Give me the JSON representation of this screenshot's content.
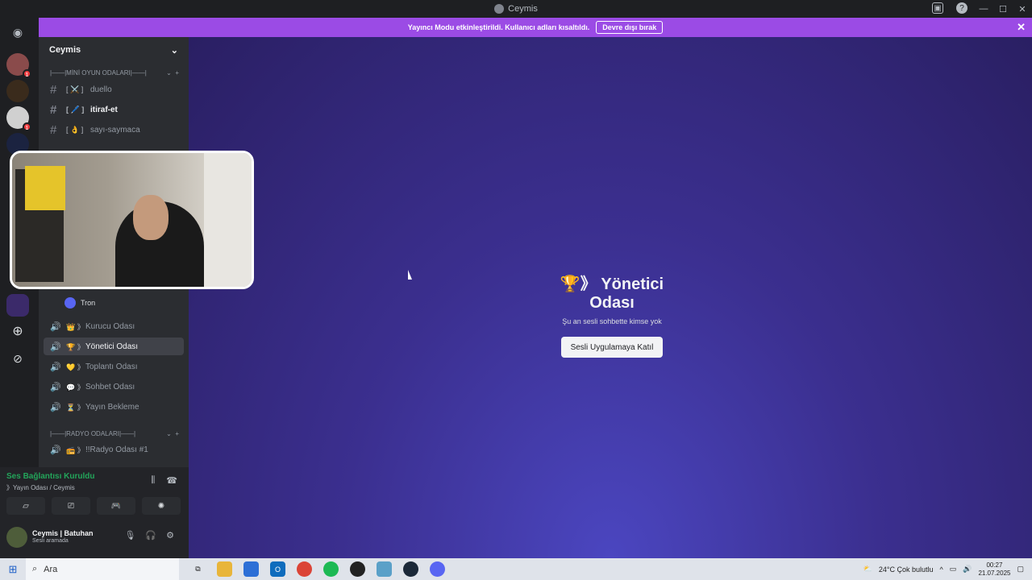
{
  "window": {
    "title": "Ceymis"
  },
  "banner": {
    "message": "Yayıncı Modu etkinleştirildi. Kullanıcı adları kısaltıldı.",
    "button_label": "Devre dışı bırak"
  },
  "guild": {
    "name": "Ceymis"
  },
  "categories": {
    "mini_games": "|——|MİNİ OYUN ODALARI|——|",
    "radio": "|——|RADYO ODALARI|——|"
  },
  "text_channels": [
    {
      "label": "duello",
      "emoji": "[ ⚔️ ]"
    },
    {
      "label": "itiraf-et",
      "emoji": "[ 🖊️ ]"
    },
    {
      "label": "sayı-saymaca",
      "emoji": "[ 👌 ]"
    }
  ],
  "voice_user": {
    "name": "Tron"
  },
  "voice_channels": [
    {
      "label": "Kurucu Odası",
      "emoji": "👑 》"
    },
    {
      "label": "Yönetici Odası",
      "emoji": "🏆 》"
    },
    {
      "label": "Toplantı Odası",
      "emoji": "💛 》"
    },
    {
      "label": "Sohbet Odası",
      "emoji": "💬 》"
    },
    {
      "label": "Yayın Bekleme",
      "emoji": "⏳ 》"
    }
  ],
  "radio_channels": [
    {
      "label": "!!Radyo Odası #1",
      "emoji": "📻 》"
    }
  ],
  "voice_panel": {
    "status": "Ses Bağlantısı Kuruldu",
    "channel": "》Yayın Odası / Ceymis"
  },
  "user_panel": {
    "name": "Ceymis | Batuhan",
    "status": "Sesli aramada"
  },
  "room": {
    "title": "🏆》 Yönetici Odası",
    "subtitle": "Şu an sesli sohbette kimse yok",
    "join_label": "Sesli Uygulamaya Katıl"
  },
  "taskbar": {
    "search_placeholder": "Ara",
    "weather": "24°C  Çok bulutlu",
    "time": "00:27",
    "date": "21.07.2025"
  }
}
